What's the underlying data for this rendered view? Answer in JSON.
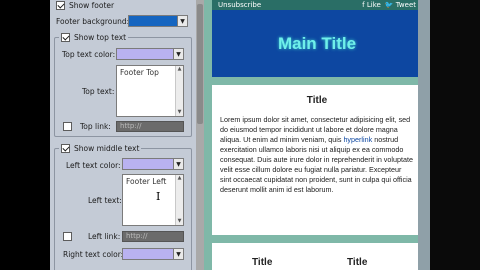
{
  "panel": {
    "show_footer": "Show footer",
    "footer_background_label": "Footer background:",
    "footer_background_color": "#1565c0",
    "top_group": {
      "title": "Show top text",
      "text_color_label": "Top text color:",
      "text_color": "#b9b2f0",
      "text_label": "Top text:",
      "text_value": "Footer Top",
      "link_label": "Top link:",
      "link_placeholder": "http://"
    },
    "middle_group": {
      "title": "Show middle text",
      "left_color_label": "Left text color:",
      "left_color": "#b9b2f0",
      "left_text_label": "Left text:",
      "left_text_value": "Footer Left",
      "left_link_label": "Left link:",
      "left_link_placeholder": "http://",
      "right_color_label": "Right text color:",
      "right_color": "#b9b2f0"
    }
  },
  "preview": {
    "unsubscribe": "Unsubscribe",
    "like": "Like",
    "tweet": "Tweet",
    "main_title": "Main Title",
    "article_title": "Title",
    "body_before_link": "Lorem ipsum dolor sit amet, consectetur adipisicing elit, sed do eiusmod tempor incididunt ut labore et dolore magna aliqua. Ut enim ad minim veniam, quis ",
    "body_link": "hyperlink",
    "body_after_link": " nostrud exercitation ullamco laboris nisi ut aliquip ex ea commodo consequat. Duis aute irure dolor in reprehenderit in voluptate velit esse cillum dolore eu fugiat nulla pariatur. Excepteur sint occaecat cupidatat non proident, sunt in culpa qui officia deserunt mollit anim id est laborum.",
    "col1_title": "Title",
    "col2_title": "Title"
  }
}
